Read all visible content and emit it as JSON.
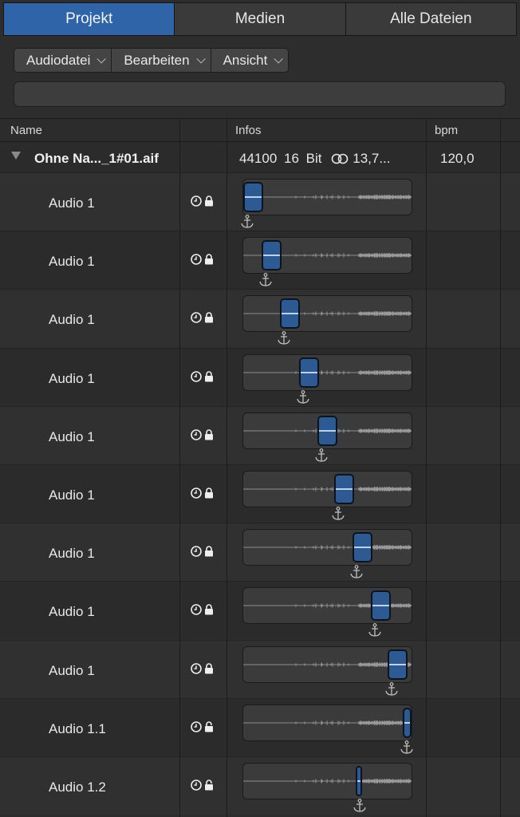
{
  "tabs": [
    "Projekt",
    "Medien",
    "Alle Dateien"
  ],
  "active_tab": 0,
  "toolbar": {
    "menus": [
      {
        "label": "Audiodatei"
      },
      {
        "label": "Bearbeiten"
      },
      {
        "label": "Ansicht"
      }
    ]
  },
  "search": {
    "placeholder": ""
  },
  "columns": {
    "name": "Name",
    "info": "Infos",
    "bpm": "bpm"
  },
  "group": {
    "name": "Ohne Na..._1#01.aif",
    "sample_rate": "44100",
    "bit_depth": "16 Bit",
    "size": "13,7...",
    "bpm": "120,0",
    "expanded": true
  },
  "regions": [
    {
      "name": "Audio 1",
      "locked": true,
      "start": 0.0,
      "width": 0.12
    },
    {
      "name": "Audio 1",
      "locked": true,
      "start": 0.11,
      "width": 0.12
    },
    {
      "name": "Audio 1",
      "locked": true,
      "start": 0.22,
      "width": 0.12
    },
    {
      "name": "Audio 1",
      "locked": true,
      "start": 0.33,
      "width": 0.12
    },
    {
      "name": "Audio 1",
      "locked": true,
      "start": 0.44,
      "width": 0.12
    },
    {
      "name": "Audio 1",
      "locked": true,
      "start": 0.54,
      "width": 0.12
    },
    {
      "name": "Audio 1",
      "locked": true,
      "start": 0.65,
      "width": 0.12
    },
    {
      "name": "Audio 1",
      "locked": true,
      "start": 0.76,
      "width": 0.12
    },
    {
      "name": "Audio 1",
      "locked": true,
      "start": 0.86,
      "width": 0.12
    },
    {
      "name": "Audio 1.1",
      "locked": false,
      "start": 0.95,
      "width": 0.05
    },
    {
      "name": "Audio 1.2",
      "locked": false,
      "start": 0.67,
      "width": 0.04
    }
  ],
  "colors": {
    "accent": "#2f64a8",
    "region": "#2e5a93",
    "background": "#2d2d2d"
  }
}
